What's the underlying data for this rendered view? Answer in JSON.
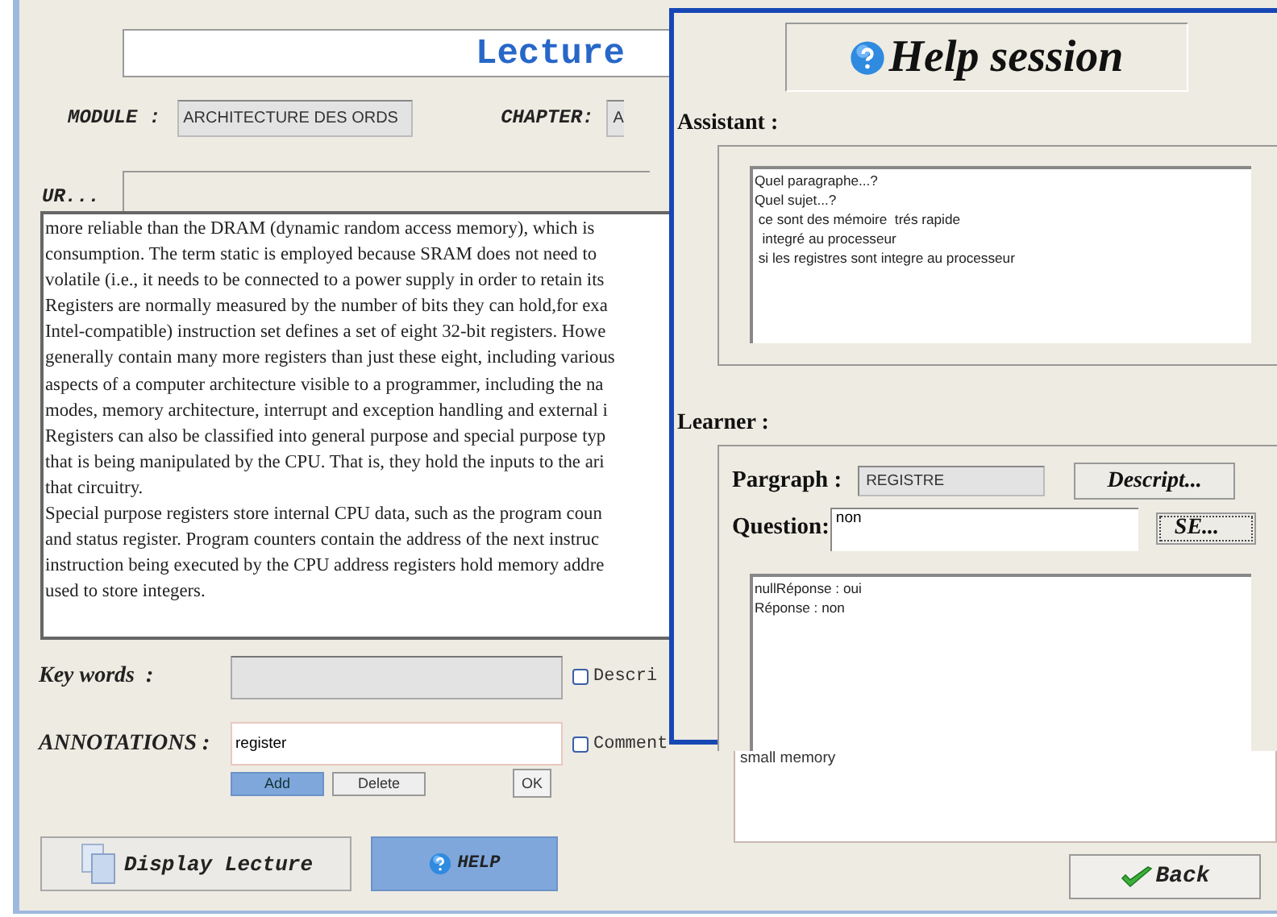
{
  "main": {
    "title": "Lecture",
    "module_label": "MODULE :",
    "module_value": "ARCHITECTURE DES ORDS",
    "chapter_label": "CHAPTER:",
    "chapter_value": "A",
    "ur_label": "UR...",
    "lecture_lines": [
      "more reliable than the DRAM (dynamic random access memory), which is",
      "consumption. The term static is employed because SRAM does not need to",
      "volatile (i.e., it needs to be connected to a power supply in order to retain its",
      "Registers are normally measured by the number of bits they can hold,for exa",
      "Intel-compatible) instruction set defines a set of eight 32-bit registers. Howe",
      "generally contain many more registers than just these eight, including various",
      "aspects of a computer architecture visible to a programmer, including the na",
      "modes, memory architecture, interrupt and exception handling and external i",
      "Registers can also be classified into general purpose and special purpose typ",
      "that is being manipulated by the CPU. That is, they hold the inputs to the ari",
      "that circuitry.",
      "Special purpose registers store internal CPU data, such as the program coun",
      "and status register. Program counters contain the address of the next instruc",
      "instruction being executed by the CPU address registers hold memory addre",
      "used to store integers."
    ],
    "keywords_label": "Key words  :",
    "description_option": {
      "label": "Descri",
      "checked": false
    },
    "annotations_label": "ANNOTATIONS :",
    "annotation_value": "register",
    "comment_option": {
      "label": "Comment",
      "checked": false
    },
    "annotation_buttons": [
      {
        "label": "Add",
        "selected": true
      },
      {
        "label": "Delete",
        "selected": false
      }
    ],
    "ok_button": "OK",
    "display_button": "Display Lecture",
    "help_button": "HELP",
    "comment_text": "small memory",
    "back_button": "Back"
  },
  "help_window": {
    "title": "Help session",
    "assistant_label": "Assistant :",
    "assistant_lines": [
      "Quel paragraphe...?",
      "Quel sujet...?",
      " ce sont des mémoire  trés rapide",
      "  integré au processeur",
      " si les registres sont integre au processeur"
    ],
    "learner_label": "Learner :",
    "paragraph_label": "Pargraph :",
    "paragraph_value": "REGISTRE",
    "describe_button": "Descript...",
    "question_label": "Question:",
    "question_value": "non",
    "send_button": "SE...",
    "response_lines": [
      "nullRéponse : oui",
      "Réponse : non"
    ]
  }
}
